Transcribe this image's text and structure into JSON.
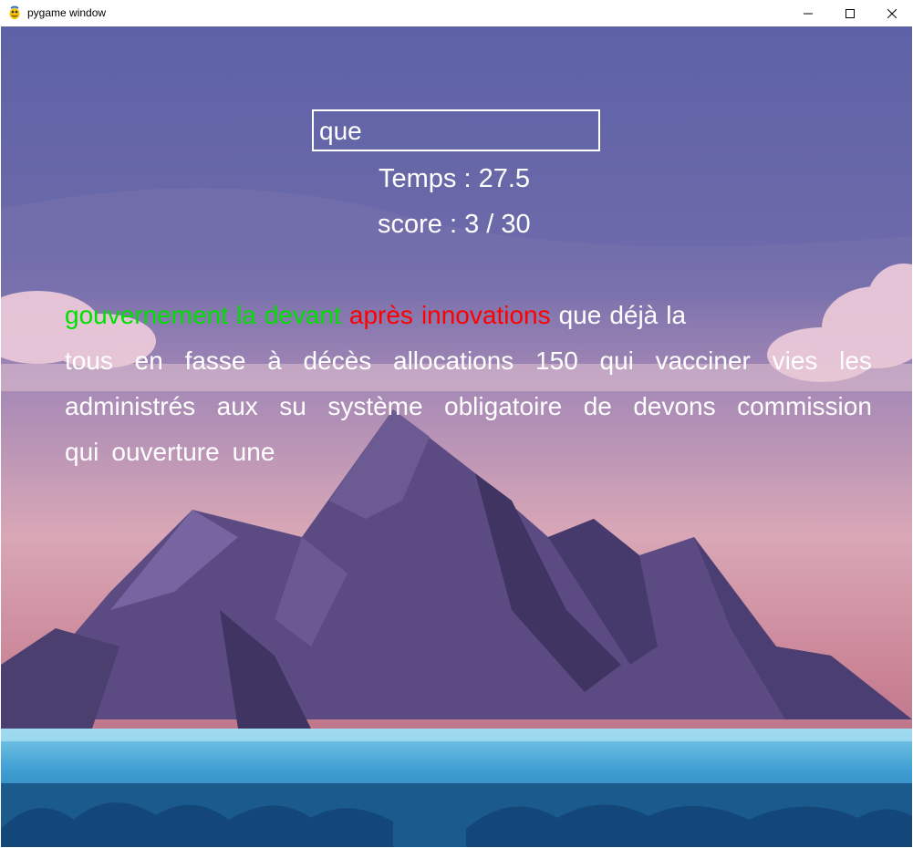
{
  "window": {
    "title": "pygame window",
    "icons": {
      "app": "pygame-snake-icon",
      "min": "minimize-icon",
      "max": "maximize-icon",
      "close": "close-icon"
    }
  },
  "game": {
    "input_value": "que",
    "timer_text": "Temps : 27.5",
    "score_text": "score : 3 / 30",
    "colors": {
      "correct": "#00e000",
      "wrong": "#ff0000",
      "pending": "#ffffff"
    },
    "lines": [
      [
        {
          "text": "gouvernement",
          "status": "correct"
        },
        {
          "text": "la",
          "status": "correct"
        },
        {
          "text": "devant",
          "status": "correct"
        },
        {
          "text": "après",
          "status": "wrong"
        },
        {
          "text": "innovations",
          "status": "wrong"
        },
        {
          "text": "que",
          "status": "pending"
        },
        {
          "text": "déjà",
          "status": "pending"
        },
        {
          "text": "la",
          "status": "pending"
        }
      ],
      [
        {
          "text": "tous",
          "status": "pending"
        },
        {
          "text": "en",
          "status": "pending"
        },
        {
          "text": "fasse",
          "status": "pending"
        },
        {
          "text": "à",
          "status": "pending"
        },
        {
          "text": "décès",
          "status": "pending"
        },
        {
          "text": "allocations",
          "status": "pending"
        },
        {
          "text": "150",
          "status": "pending"
        },
        {
          "text": "qui",
          "status": "pending"
        },
        {
          "text": "vacciner",
          "status": "pending"
        },
        {
          "text": "vies",
          "status": "pending"
        },
        {
          "text": "les",
          "status": "pending"
        }
      ],
      [
        {
          "text": "administrés",
          "status": "pending"
        },
        {
          "text": "aux",
          "status": "pending"
        },
        {
          "text": "su",
          "status": "pending"
        },
        {
          "text": "système",
          "status": "pending"
        },
        {
          "text": "obligatoire",
          "status": "pending"
        },
        {
          "text": "de",
          "status": "pending"
        },
        {
          "text": "devons",
          "status": "pending"
        },
        {
          "text": "commission",
          "status": "pending"
        }
      ],
      [
        {
          "text": "qui",
          "status": "pending"
        },
        {
          "text": "ouverture",
          "status": "pending"
        },
        {
          "text": "une",
          "status": "pending"
        }
      ]
    ]
  }
}
